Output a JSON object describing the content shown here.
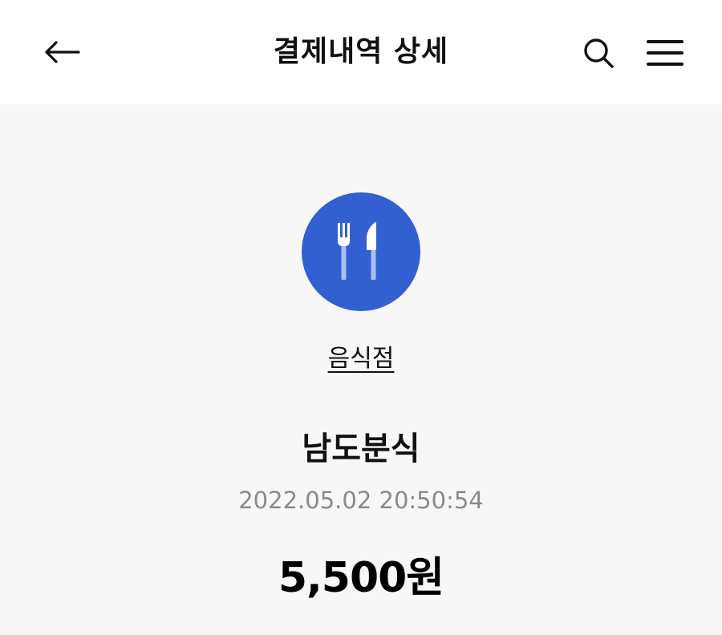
{
  "header": {
    "title": "결제내역 상세",
    "back_icon": "arrow-left-icon",
    "search_icon": "search-icon",
    "menu_icon": "hamburger-menu-icon"
  },
  "detail": {
    "category_icon": "fork-knife-icon",
    "category_label": "음식점",
    "merchant_name": "남도분식",
    "datetime": "2022.05.02 20:50:54",
    "amount": "5,500원"
  },
  "colors": {
    "header_bg": "#ffffff",
    "page_bg": "#f7f7f7",
    "category_circle": "#3260d0",
    "icon_fg": "#ffffff",
    "icon_fg_light": "#a9c0f2",
    "timestamp_text": "#8a8a8a"
  }
}
